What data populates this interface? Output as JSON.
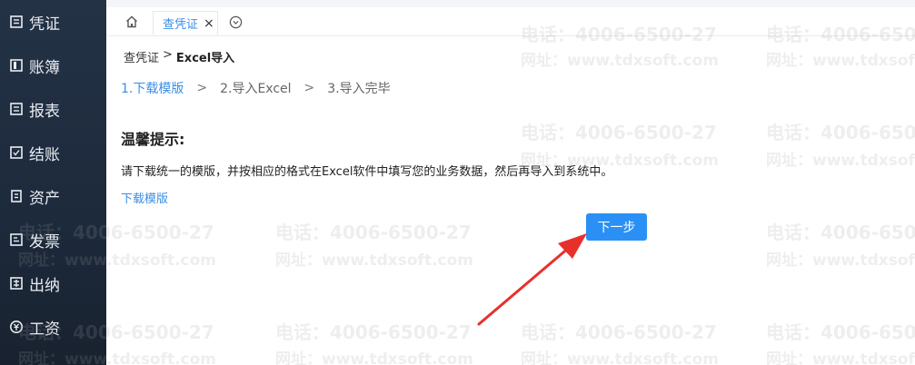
{
  "sidebar": {
    "items": [
      {
        "label": "凭证",
        "icon": "voucher-icon"
      },
      {
        "label": "账簿",
        "icon": "ledger-icon"
      },
      {
        "label": "报表",
        "icon": "report-icon"
      },
      {
        "label": "结账",
        "icon": "checkout-icon"
      },
      {
        "label": "资产",
        "icon": "asset-icon"
      },
      {
        "label": "发票",
        "icon": "invoice-icon"
      },
      {
        "label": "出纳",
        "icon": "cashier-icon"
      },
      {
        "label": "工资",
        "icon": "salary-icon"
      }
    ]
  },
  "tabs": {
    "home_icon": "home-icon",
    "active_tab": {
      "label": "查凭证",
      "close": "×"
    },
    "more_icon": "chevron-down-circle-icon"
  },
  "breadcrumb": {
    "parent": "查凭证",
    "separator": ">",
    "current": "Excel导入"
  },
  "steps": {
    "items": [
      "1.下载模版",
      "2.导入Excel",
      "3.导入完毕"
    ],
    "separator": ">",
    "active_index": 0
  },
  "tip": {
    "title": "温馨提示:",
    "body": "请下载统一的模版，并按相应的格式在Excel软件中填写您的业务数据，然后再导入到系统中。",
    "download_link": "下载模版"
  },
  "actions": {
    "next_label": "下一步"
  },
  "watermark": {
    "phone": "电话：4006-6500-27",
    "url": "网址：www.tdxsoft.com"
  },
  "colors": {
    "accent": "#3a8ee6",
    "button": "#2a90f5",
    "sidebar": "#1d2a3c",
    "arrow": "#e8302a"
  }
}
